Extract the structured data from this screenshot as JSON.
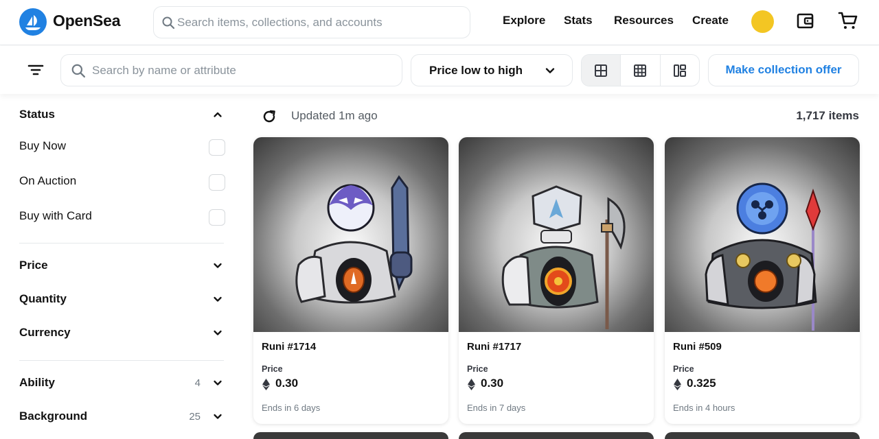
{
  "header": {
    "brand": "OpenSea",
    "search_placeholder": "Search items, collections, and accounts",
    "nav": [
      "Explore",
      "Stats",
      "Resources",
      "Create"
    ]
  },
  "toolbar": {
    "attr_search_placeholder": "Search by name or attribute",
    "sort_label": "Price low to high",
    "offer_label": "Make collection offer"
  },
  "sidebar": {
    "status_title": "Status",
    "status_options": [
      "Buy Now",
      "On Auction",
      "Buy with Card"
    ],
    "filters": [
      {
        "label": "Price",
        "count": ""
      },
      {
        "label": "Quantity",
        "count": ""
      },
      {
        "label": "Currency",
        "count": ""
      },
      {
        "label": "Ability",
        "count": "4"
      },
      {
        "label": "Background",
        "count": "25"
      }
    ]
  },
  "results": {
    "updated": "Updated 1m ago",
    "count": "1,717 items"
  },
  "cards": [
    {
      "name": "Runi #1714",
      "price_label": "Price",
      "price": "0.30",
      "ends": "Ends in 6 days"
    },
    {
      "name": "Runi #1717",
      "price_label": "Price",
      "price": "0.30",
      "ends": "Ends in 7 days"
    },
    {
      "name": "Runi #509",
      "price_label": "Price",
      "price": "0.325",
      "ends": "Ends in 4 hours"
    }
  ],
  "colors": {
    "accent": "#2081e2",
    "avatar": "#f3c623"
  }
}
